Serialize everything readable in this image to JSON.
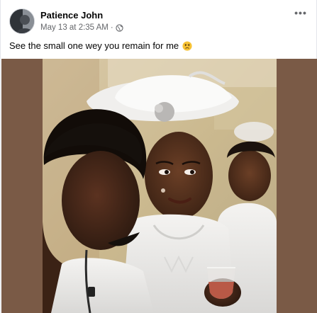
{
  "post": {
    "author": "Patience John",
    "timestamp": "May 13 at 2:35 AM",
    "separator": "·",
    "audience_icon": "globe-icon",
    "more_icon": "more-horizontal-icon",
    "more_label": "•••",
    "caption": "See the small one wey you remain for me",
    "caption_emoji": "sad-face-emoji"
  },
  "colors": {
    "photo_frame": "#7a5a46",
    "author_text": "#050505",
    "meta_text": "#65676b"
  }
}
